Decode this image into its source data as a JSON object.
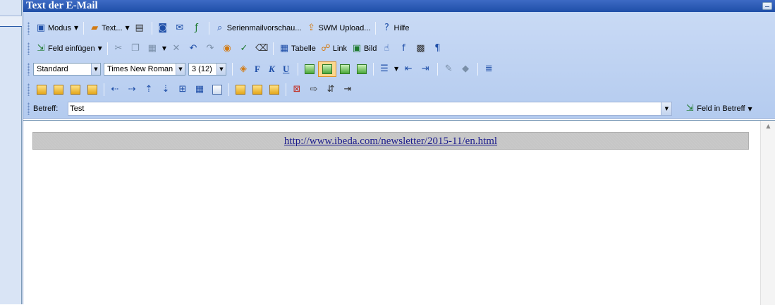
{
  "window": {
    "title": "Text der E-Mail"
  },
  "toolbar1": {
    "modus": "Modus",
    "text": "Text...",
    "serienmail": "Serienmailvorschau...",
    "swm_upload": "SWM Upload...",
    "hilfe": "Hilfe"
  },
  "toolbar2": {
    "feld_einfuegen": "Feld einfügen",
    "tabelle": "Tabelle",
    "link": "Link",
    "bild": "Bild"
  },
  "toolbar3": {
    "style": "Standard",
    "font": "Times New Roman",
    "size": "3 (12)",
    "bold": "F",
    "italic": "K",
    "underline": "U"
  },
  "subject": {
    "label": "Betreff:",
    "value": "Test",
    "feld_in_betreff": "Feld in Betreff"
  },
  "editor": {
    "link_text": "http://www.ibeda.com/newsletter/2015-11/en.html"
  },
  "colors": {
    "accent": "#1f4fa8",
    "toolbar_bg": "#c9daf5",
    "selected": "#fbd78f"
  }
}
